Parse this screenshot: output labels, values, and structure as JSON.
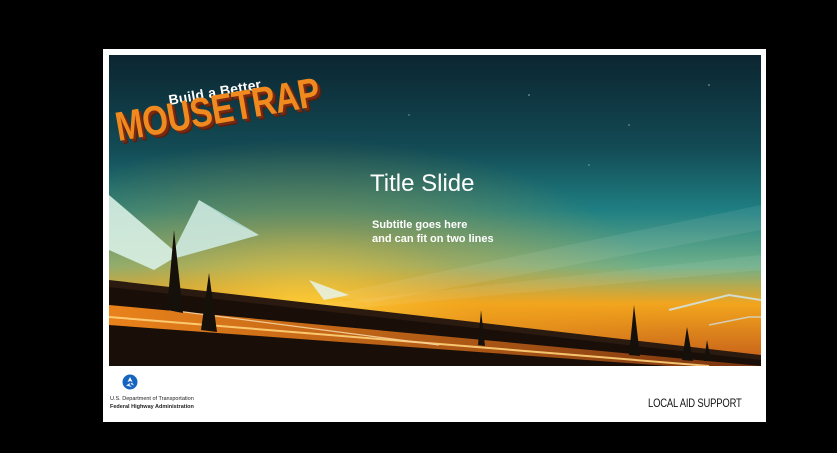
{
  "slide": {
    "title": "Title Slide",
    "subtitle_line1": "Subtitle goes here",
    "subtitle_line2": "and can fit on two lines"
  },
  "logo": {
    "tagline": "Build a Better",
    "word": "MOUSETRAP"
  },
  "footer": {
    "department": "U.S. Department of Transportation",
    "agency": "Federal Highway Administration",
    "program": "LOCAL AID SUPPORT",
    "dot_icon": "dot-triskelion-icon"
  },
  "colors": {
    "background": "#000000",
    "sky_top": "#0b2530",
    "sky_teal": "#1f7f82",
    "horizon_glow": "#f2a51d",
    "road_orange": "#e9821b",
    "logo_orange": "#f08a1e",
    "dot_blue": "#1565c0"
  }
}
